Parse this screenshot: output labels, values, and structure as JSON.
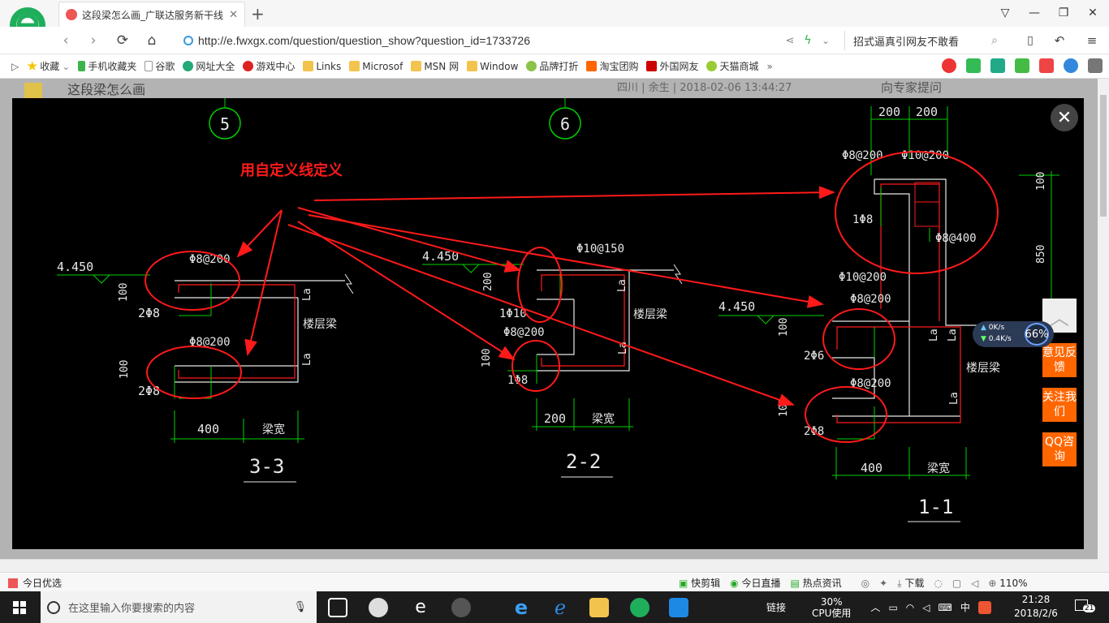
{
  "browser": {
    "tab_title": "这段梁怎么画_广联达服务新干线",
    "url": "http://e.fwxgx.com/question/question_show?question_id=1733726",
    "search_text": "招式逼真引网友不敢看",
    "bookmarks": [
      "收藏",
      "手机收藏夹",
      "谷歌",
      "网址大全",
      "游戏中心",
      "Links",
      "Microsof",
      "MSN 网",
      "Window",
      "品牌打折",
      "淘宝团购",
      "外国网友",
      "天猫商城"
    ],
    "more": "»"
  },
  "page": {
    "question_title": "这段梁怎么画",
    "question_meta": "四川 | 余生 | 2018-02-06 13:44:27",
    "side_heading": "向专家提问"
  },
  "drawing": {
    "annotation": "用自定义线定义",
    "axes": [
      "5",
      "6"
    ],
    "sections": [
      {
        "name": "3-3",
        "elevation": "4.450",
        "top_stirrup": "Φ8@200",
        "top_height": "100",
        "top_bars": "2Φ8",
        "bottom_stirrup": "Φ8@200",
        "bottom_height": "100",
        "bottom_bars": "2Φ8",
        "width": "400",
        "beam_width": "梁宽",
        "beam_label": "楼层梁",
        "lap": "La"
      },
      {
        "name": "2-2",
        "elevation": "4.450",
        "top_stirrup": "Φ10@150",
        "top_height": "200",
        "top_bars": "1Φ10",
        "bottom_stirrup": "Φ8@200",
        "bottom_height": "100",
        "bottom_bars": "1Φ8",
        "width": "200",
        "beam_width": "梁宽",
        "beam_label": "楼层梁",
        "lap": "La"
      },
      {
        "name": "1-1",
        "elevation": "4.450",
        "dim_top": [
          "200",
          "200"
        ],
        "top_stirrups": [
          "Φ8@200",
          "Φ10@200"
        ],
        "upper_bars": "1Φ8",
        "upper_stirrup": "Φ8@400",
        "height_100": "100",
        "height_850": "850",
        "mid_stirrups": [
          "Φ10@200",
          "Φ8@200"
        ],
        "mid_height": "100",
        "mid_bars": "2Φ6",
        "bottom_stirrup": "Φ8@200",
        "bottom_height": "100",
        "bottom_bars": "2Φ8",
        "width": "400",
        "beam_width": "梁宽",
        "beam_label": "楼层梁",
        "lap": "La"
      }
    ]
  },
  "sidebar_buttons": {
    "feedback": "意见反馈",
    "follow": "关注我们",
    "qq": "QQ咨询"
  },
  "net_widget": {
    "up": "0K/s",
    "down": "0.4K/s",
    "percent": "66%"
  },
  "statusbar": {
    "left": "今日优选",
    "items": [
      "快剪辑",
      "今日直播",
      "热点资讯"
    ],
    "download": "下载",
    "zoom": "110%"
  },
  "taskbar": {
    "search_placeholder": "在这里输入你要搜索的内容",
    "links": "链接",
    "cpu_percent": "30%",
    "cpu_label": "CPU使用",
    "ime": "中",
    "time": "21:28",
    "date": "2018/2/6",
    "notifications": "21"
  },
  "colors": {
    "accent": "#ff6600",
    "cad_red": "#ff1a1a",
    "cad_green": "#00d000",
    "cad_white": "#e8e8e8",
    "cad_yellow": "#ffff66"
  }
}
